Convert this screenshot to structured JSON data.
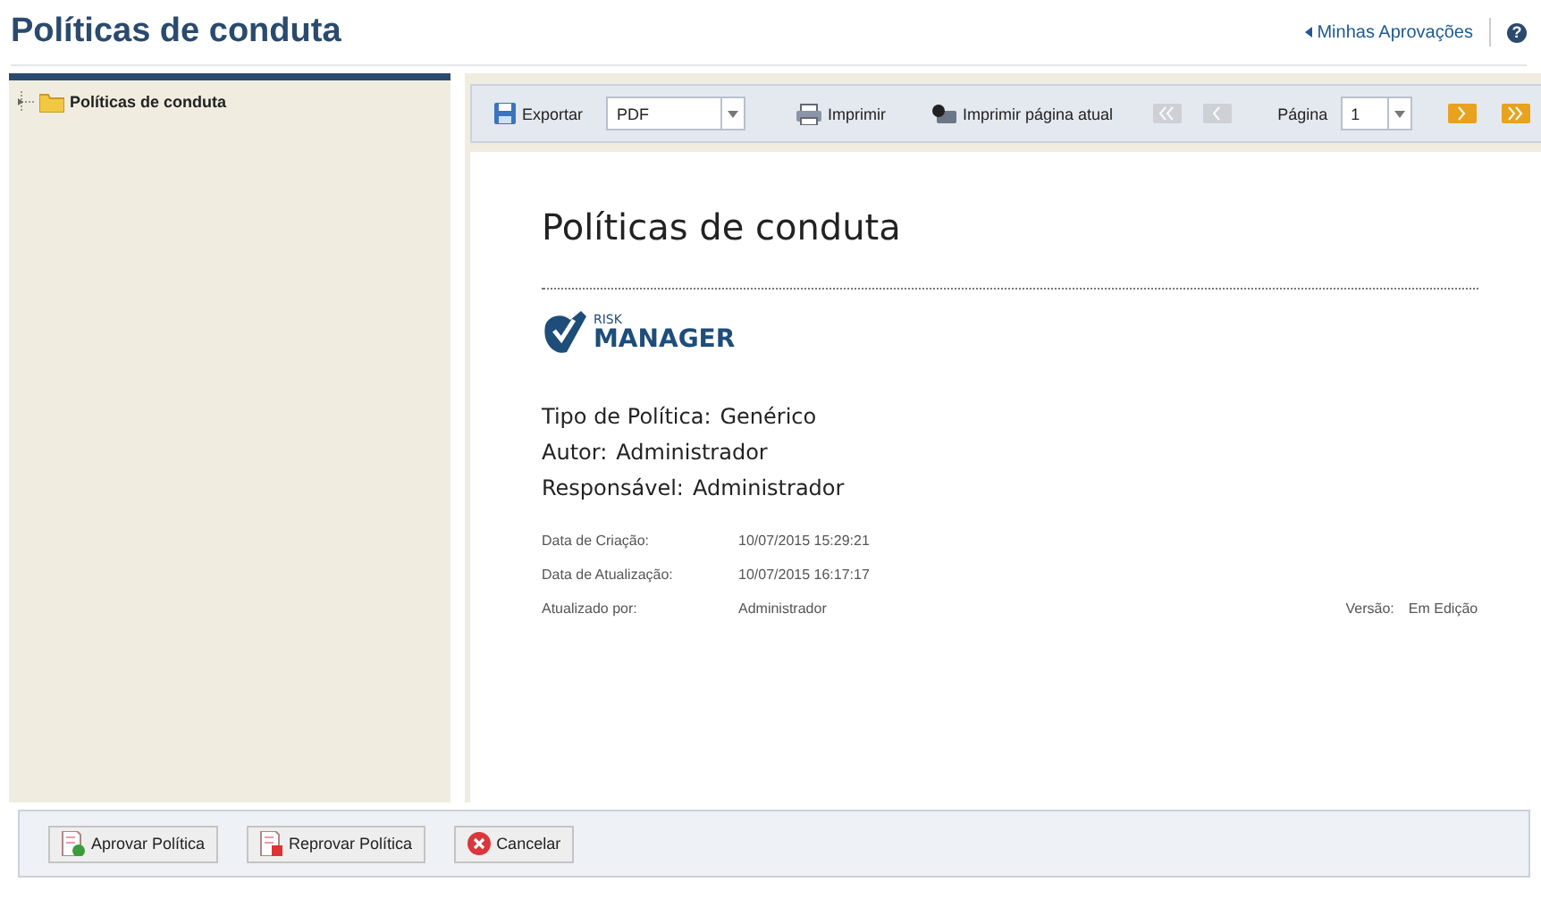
{
  "header": {
    "title": "Políticas de conduta",
    "link": "Minhas Aprovações",
    "help": "?"
  },
  "tree": {
    "items": [
      {
        "label": "Políticas de conduta",
        "expanded": false
      }
    ]
  },
  "toolbar": {
    "export": "Exportar",
    "format": "PDF",
    "print": "Imprimir",
    "print_page": "Imprimir página atual",
    "page_label": "Página",
    "page": "1",
    "nav": [
      {
        "kind": "first",
        "disabled": true
      },
      {
        "kind": "prev",
        "disabled": true
      },
      {
        "kind": "next",
        "disabled": false
      },
      {
        "kind": "last",
        "disabled": false
      }
    ]
  },
  "report": {
    "title": "Políticas de conduta",
    "logo": {
      "small": "RISK",
      "big": "MANAGER"
    },
    "fields": [
      {
        "label": "Tipo de Política:",
        "value": "Genérico"
      },
      {
        "label": "Autor:",
        "value": "Administrador"
      },
      {
        "label": "Responsável:",
        "value": "Administrador"
      }
    ],
    "details": [
      {
        "label": "Data de Criação:",
        "value": "10/07/2015 15:29:21"
      },
      {
        "label": "Data de Atualização:",
        "value": "10/07/2015 16:17:17"
      },
      {
        "label": "Atualizado por:",
        "value": "Administrador",
        "extra_label": "Versão:",
        "extra_value": "Em Edição"
      }
    ]
  },
  "footer": {
    "buttons": [
      {
        "kind": "approve",
        "label": "Aprovar Política"
      },
      {
        "kind": "reject",
        "label": "Reprovar Política"
      },
      {
        "kind": "cancel",
        "label": "Cancelar"
      }
    ]
  }
}
